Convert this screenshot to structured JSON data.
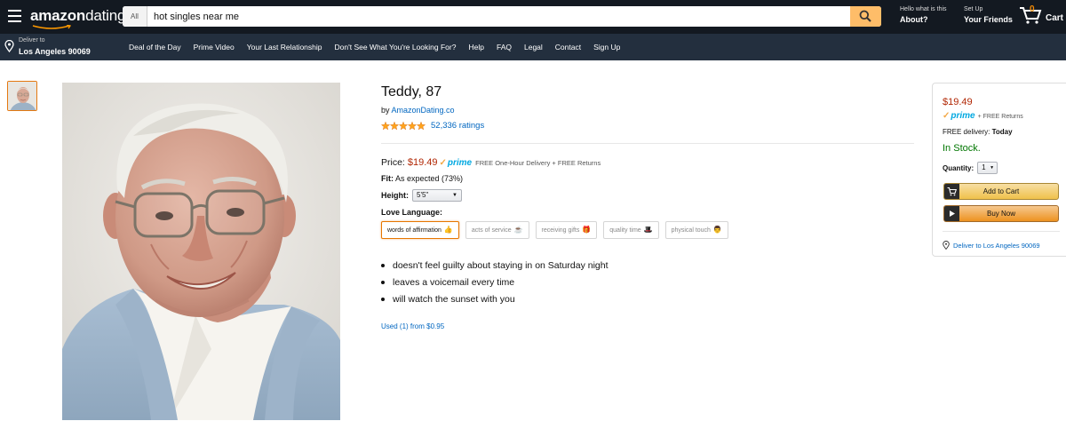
{
  "header": {
    "logo_main": "amazon",
    "logo_sub": "dating",
    "search_category": "All",
    "search_value": "hot singles near me",
    "account_small": "Hello what is this",
    "account_big": "About?",
    "setup_small": "Set Up",
    "setup_big": "Your Friends",
    "cart_count": "0",
    "cart_label": "Cart"
  },
  "subnav": {
    "deliver_small": "Deliver to",
    "deliver_big": "Los Angeles 90069",
    "links": [
      "Deal of the Day",
      "Prime Video",
      "Your Last Relationship",
      "Don't See What You're Looking For?",
      "Help",
      "FAQ",
      "Legal",
      "Contact",
      "Sign Up"
    ]
  },
  "product": {
    "title": "Teddy, 87",
    "by_label": "by ",
    "by_link": "AmazonDating.co",
    "star_rating": 5,
    "ratings": "52,336 ratings",
    "price_label": "Price:",
    "price": "$19.49",
    "prime_label": "prime",
    "shipping_note": "FREE One-Hour Delivery + FREE Returns",
    "fit_label": "Fit:",
    "fit_value": "As expected (73%)",
    "height_label": "Height:",
    "height_value": "5'5\"",
    "love_language_label": "Love Language:",
    "love_languages": [
      {
        "label": "words of affirmation",
        "emoji": "👍",
        "selected": true
      },
      {
        "label": "acts of service",
        "emoji": "☕",
        "selected": false
      },
      {
        "label": "receiving gifts",
        "emoji": "🎁",
        "selected": false
      },
      {
        "label": "quality time",
        "emoji": "🎩",
        "selected": false
      },
      {
        "label": "physical touch",
        "emoji": "👨",
        "selected": false
      }
    ],
    "bullets": [
      "doesn't feel guilty about staying in on Saturday night",
      "leaves a voicemail every time",
      "will watch the sunset with you"
    ],
    "used_link": "Used (1) from $0.95"
  },
  "buybox": {
    "price": "$19.49",
    "prime_label": "prime",
    "returns": "+ FREE Returns",
    "delivery_label": "FREE delivery:",
    "delivery_day": "Today",
    "stock": "In Stock.",
    "quantity_label": "Quantity:",
    "quantity_value": "1",
    "add_to_cart": "Add to Cart",
    "buy_now": "Buy Now",
    "deliver_to": "Deliver to Los Angeles 90069"
  },
  "colors": {
    "nav_dark": "#131921",
    "nav_secondary": "#232f3e",
    "search_button": "#febd69",
    "price_red": "#b12704",
    "link_blue": "#0066c0",
    "stock_green": "#007600",
    "prime_blue": "#00a8e1",
    "star_orange": "#ffa41c"
  },
  "icons": {
    "menu": "hamburger-icon",
    "search": "magnifier-icon",
    "cart": "cart-icon",
    "location": "location-pin-icon",
    "stars": "star-icon"
  }
}
